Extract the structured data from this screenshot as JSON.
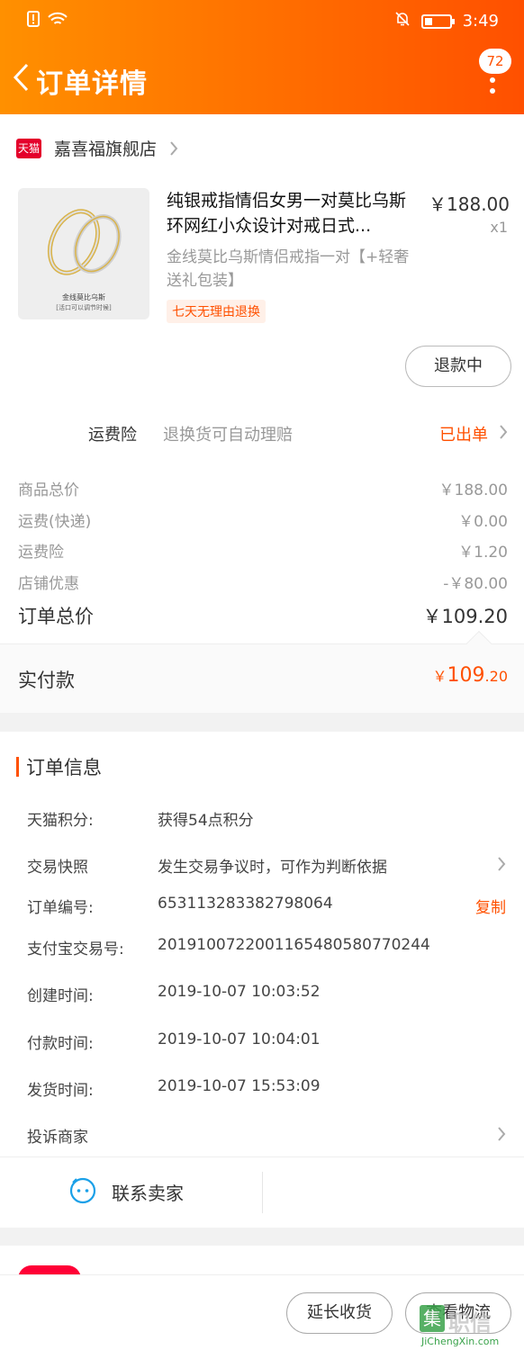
{
  "status_bar": {
    "time": "3:49"
  },
  "header": {
    "title": "订单详情",
    "badge_count": "72"
  },
  "shop": {
    "platform_tag": "天猫",
    "name": "嘉喜福旗舰店"
  },
  "product": {
    "title": "纯银戒指情侣女男一对莫比乌斯环网红小众设计对戒日式...",
    "sku": "金线莫比乌斯情侣戒指一对【+轻奢送礼包装】",
    "tag": "七天无理由退换",
    "price": "￥188.00",
    "qty": "x1",
    "thumb_caption": "金线莫比乌斯",
    "thumb_subcaption": "[活口可以调节时候]",
    "refund_button": "退款中"
  },
  "insurance": {
    "label": "运费险",
    "desc": "退换货可自动理赔",
    "status": "已出单"
  },
  "summary": {
    "rows": [
      {
        "k": "商品总价",
        "v": "￥188.00"
      },
      {
        "k": "运费(快递)",
        "v": "￥0.00"
      },
      {
        "k": "运费险",
        "v": "￥1.20"
      },
      {
        "k": "店铺优惠",
        "v": "-￥80.00"
      }
    ],
    "total_label": "订单总价",
    "total_value": "￥109.20",
    "paid_label": "实付款",
    "paid_symbol": "￥",
    "paid_int": "109",
    "paid_dec": ".20"
  },
  "order_info": {
    "title": "订单信息",
    "rows": [
      {
        "k": "天猫积分:",
        "v": "获得54点积分"
      },
      {
        "k": "交易快照",
        "v": "发生交易争议时，可作为判断依据"
      },
      {
        "k": "订单编号:",
        "v": "653113283382798064",
        "action": "复制"
      },
      {
        "k": "支付宝交易号:",
        "v": "2019100722001165480580770244"
      },
      {
        "k": "创建时间:",
        "v": "2019-10-07 10:03:52"
      },
      {
        "k": "付款时间:",
        "v": "2019-10-07 10:04:01"
      },
      {
        "k": "发货时间:",
        "v": "2019-10-07 15:53:09"
      },
      {
        "k": "投诉商家",
        "v": ""
      }
    ],
    "contact_label": "联系卖家"
  },
  "bottom_bar": {
    "extend_label": "延长收货",
    "logistics_label": "查看物流"
  },
  "watermark": {
    "text": "职信",
    "sub": "JiChengXin.com"
  },
  "colors": {
    "accent": "#ff5000",
    "header_start": "#ff9000",
    "header_end": "#ff5000",
    "tmall_red": "#e4002b"
  }
}
